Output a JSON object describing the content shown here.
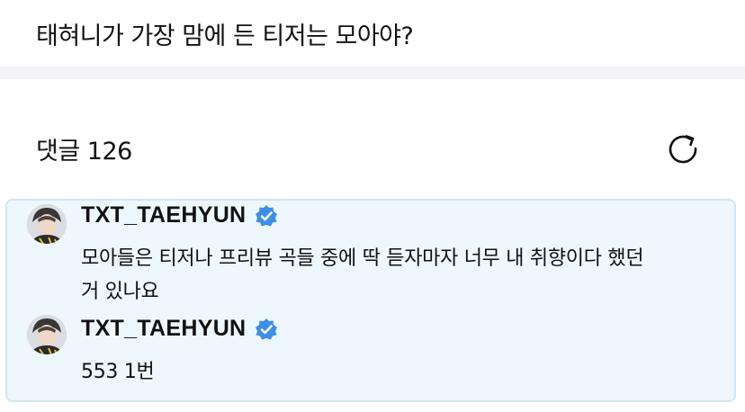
{
  "post": {
    "question": "태혀니가 가장 맘에 든 티저는 모아야?"
  },
  "comments": {
    "header": "댓글 126",
    "refresh_icon": "refresh-icon",
    "thread": [
      {
        "author": "TXT_TAEHYUN",
        "verified": true,
        "body_line1": "모아들은 티저나 프리뷰 곡들 중에 딱 듣자마자 너무 내 취향이다 했던",
        "body_line2": "거 있나요"
      },
      {
        "author": "TXT_TAEHYUN",
        "verified": true,
        "body": "553 1번"
      }
    ]
  },
  "colors": {
    "highlight_bg": "#eef7fc",
    "highlight_border": "#cfe6f2",
    "verified_badge": "#3d8ee8"
  }
}
